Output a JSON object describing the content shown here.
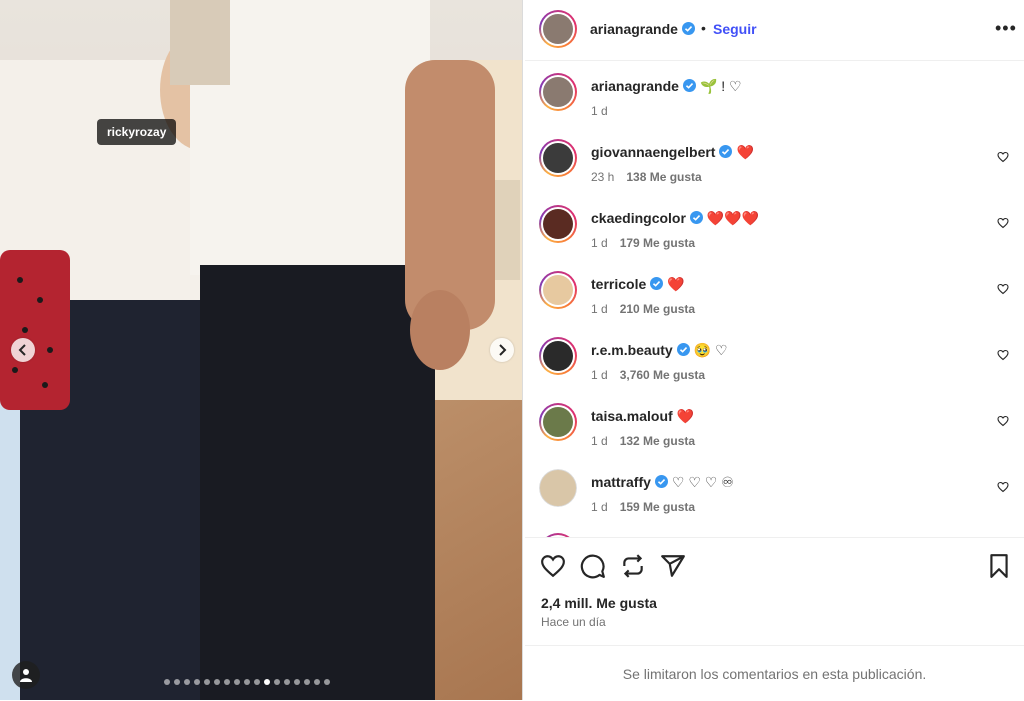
{
  "media": {
    "tagged_user": "ricky­rozay",
    "slide_count": 17,
    "active_slide": 10
  },
  "header": {
    "username": "arianagrande",
    "separator": "•",
    "follow_label": "Seguir",
    "more_label": "•••"
  },
  "caption": {
    "username": "arianagrande",
    "text": "🌱 !  ♡",
    "time": "1 d"
  },
  "comments": [
    {
      "username": "giovannaengelbert",
      "verified": true,
      "text": "❤️",
      "time": "23 h",
      "likes": "138 Me gusta"
    },
    {
      "username": "ckaedingcolor",
      "verified": true,
      "text": "❤️❤️❤️",
      "time": "1 d",
      "likes": "179 Me gusta"
    },
    {
      "username": "terricole",
      "verified": true,
      "text": "❤️",
      "time": "1 d",
      "likes": "210 Me gusta"
    },
    {
      "username": "r.e.m.beauty",
      "verified": true,
      "text": "🥹 ♡",
      "time": "1 d",
      "likes": "3,760 Me gusta"
    },
    {
      "username": "taisa.malouf",
      "verified": false,
      "text": "❤️",
      "time": "1 d",
      "likes": "132 Me gusta"
    },
    {
      "username": "mattraffy",
      "verified": true,
      "text": "♡ ♡ ♡ ♾",
      "time": "1 d",
      "likes": "159 Me gusta"
    }
  ],
  "actions": {
    "likes_count": "2,4 mill. Me gusta",
    "time_ago": "Hace un día"
  },
  "footer": {
    "limited_text": "Se limitaron los comentarios en esta publicación."
  },
  "colors": {
    "follow": "#4150f7",
    "verified": "#3897f0",
    "heart_red": "#ed4956"
  }
}
